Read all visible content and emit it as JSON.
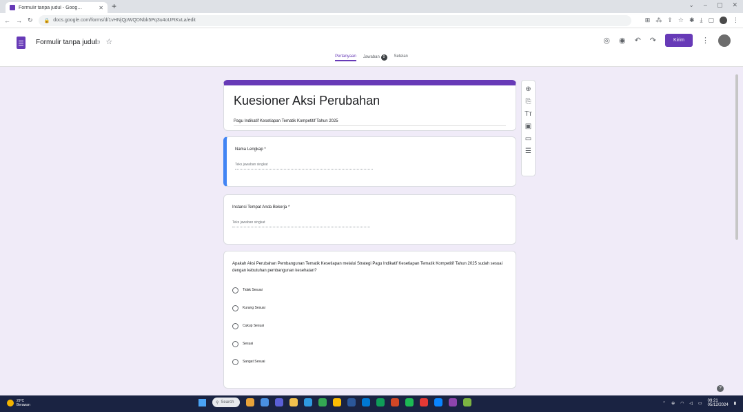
{
  "browser": {
    "tab_title": "Formulir tanpa judul - Goog…",
    "url": "docs.google.com/forms/d/1vHNjQpWQDNbk5Pq3u4oUFtKvLa/edit"
  },
  "forms_header": {
    "doc_title": "Formulir tanpa judul",
    "send_label": "Kirim",
    "tabs": [
      "Pertanyaan",
      "Jawaban",
      "Setelan"
    ],
    "responses_count": "0"
  },
  "form": {
    "title": "Kuesioner Aksi Perubahan",
    "description": "Pagu Indikatif Kesetiapan Tematik Kompetitif Tahun 2025",
    "questions": [
      {
        "label": "Nama Lengkap *",
        "placeholder": "Teks jawaban singkat"
      },
      {
        "label": "Instansi Tempat Anda Bekerja *",
        "placeholder": "Teks jawaban singkat"
      },
      {
        "label": "Apakah Aksi Perubahan Pembangunan Tematik Kesetiapan melalui Strategi Pagu Indikatif Kesetiapan Tematik Kompetitif Tahun 2025 sudah sesuai dengan kebutuhan pembangunan kesehatan?",
        "options": [
          "Tidak Sesuai",
          "Kurang Sesuai",
          "Cukup Sesuai",
          "Sesuai",
          "Sangat Sesuai"
        ]
      }
    ]
  },
  "taskbar": {
    "weather_temp": "29°C",
    "weather_desc": "Berawan",
    "search_placeholder": "Search",
    "time": "09:21",
    "date": "05/12/2024"
  }
}
